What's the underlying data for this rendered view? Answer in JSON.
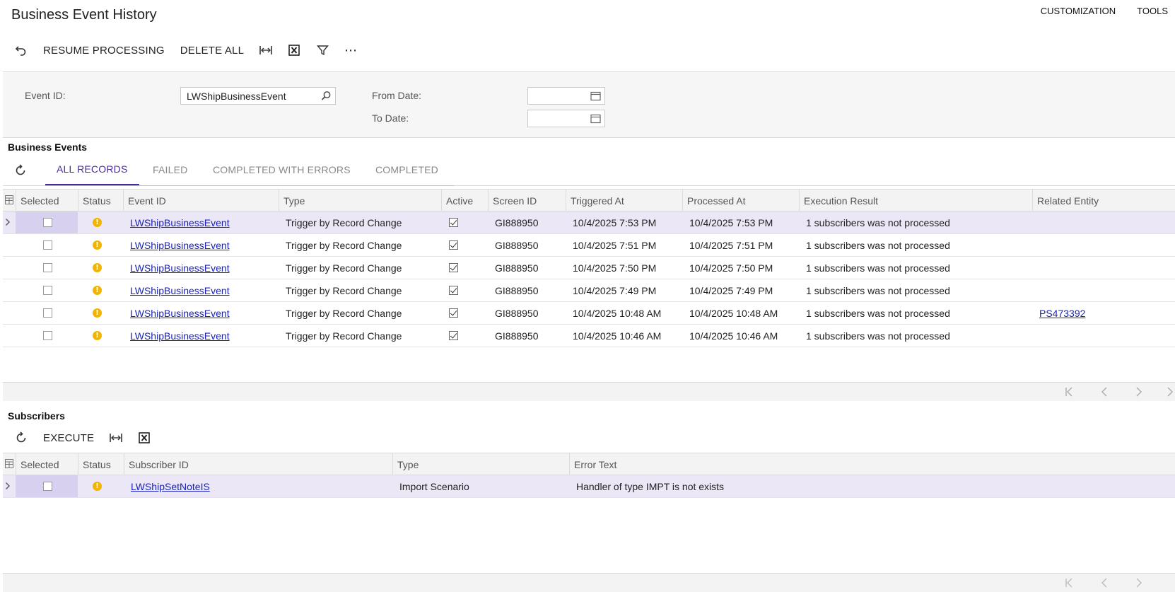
{
  "header": {
    "title": "Business Event History",
    "menu": [
      "CUSTOMIZATION",
      "TOOLS"
    ]
  },
  "toolbar": {
    "undo_icon": "undo-icon",
    "resume_label": "RESUME PROCESSING",
    "delete_label": "DELETE ALL",
    "fit_icon": "fit-columns-icon",
    "excel_icon": "excel-icon",
    "filter_icon": "filter-icon",
    "more_label": "⋯"
  },
  "filters": {
    "event_id_label": "Event ID:",
    "event_id_value": "LWShipBusinessEvent",
    "from_date_label": "From Date:",
    "from_date_value": "",
    "to_date_label": "To Date:",
    "to_date_value": ""
  },
  "events": {
    "title": "Business Events",
    "tabs": [
      "ALL RECORDS",
      "FAILED",
      "COMPLETED WITH ERRORS",
      "COMPLETED"
    ],
    "active_tab": "ALL RECORDS",
    "columns": [
      "Selected",
      "Status",
      "Event ID",
      "Type",
      "Active",
      "Screen ID",
      "Triggered At",
      "Processed At",
      "Execution Result",
      "Related Entity"
    ],
    "rows": [
      {
        "event_id": "LWShipBusinessEvent",
        "type": "Trigger by Record Change",
        "active": true,
        "screen_id": "GI888950",
        "triggered": "10/4/2025 7:53 PM",
        "processed": "10/4/2025 7:53 PM",
        "result": "1 subscribers was not processed",
        "related": ""
      },
      {
        "event_id": "LWShipBusinessEvent",
        "type": "Trigger by Record Change",
        "active": true,
        "screen_id": "GI888950",
        "triggered": "10/4/2025 7:51 PM",
        "processed": "10/4/2025 7:51 PM",
        "result": "1 subscribers was not processed",
        "related": ""
      },
      {
        "event_id": "LWShipBusinessEvent",
        "type": "Trigger by Record Change",
        "active": true,
        "screen_id": "GI888950",
        "triggered": "10/4/2025 7:50 PM",
        "processed": "10/4/2025 7:50 PM",
        "result": "1 subscribers was not processed",
        "related": ""
      },
      {
        "event_id": "LWShipBusinessEvent",
        "type": "Trigger by Record Change",
        "active": true,
        "screen_id": "GI888950",
        "triggered": "10/4/2025 7:49 PM",
        "processed": "10/4/2025 7:49 PM",
        "result": "1 subscribers was not processed",
        "related": ""
      },
      {
        "event_id": "LWShipBusinessEvent",
        "type": "Trigger by Record Change",
        "active": true,
        "screen_id": "GI888950",
        "triggered": "10/4/2025 10:48 AM",
        "processed": "10/4/2025 10:48 AM",
        "result": "1 subscribers was not processed",
        "related": "PS473392"
      },
      {
        "event_id": "LWShipBusinessEvent",
        "type": "Trigger by Record Change",
        "active": true,
        "screen_id": "GI888950",
        "triggered": "10/4/2025 10:46 AM",
        "processed": "10/4/2025 10:46 AM",
        "result": "1 subscribers was not processed",
        "related": ""
      }
    ]
  },
  "subscribers": {
    "title": "Subscribers",
    "execute_label": "EXECUTE",
    "columns": [
      "Selected",
      "Status",
      "Subscriber ID",
      "Type",
      "Error Text"
    ],
    "rows": [
      {
        "subscriber_id": "LWShipSetNoteIS",
        "type": "Import Scenario",
        "error": "Handler of type IMPT is not exists"
      }
    ]
  },
  "colors": {
    "accent": "#4a2aa0",
    "link": "#1a22b8",
    "warning": "#f1b400",
    "selected_row": "#ebe7f6"
  }
}
